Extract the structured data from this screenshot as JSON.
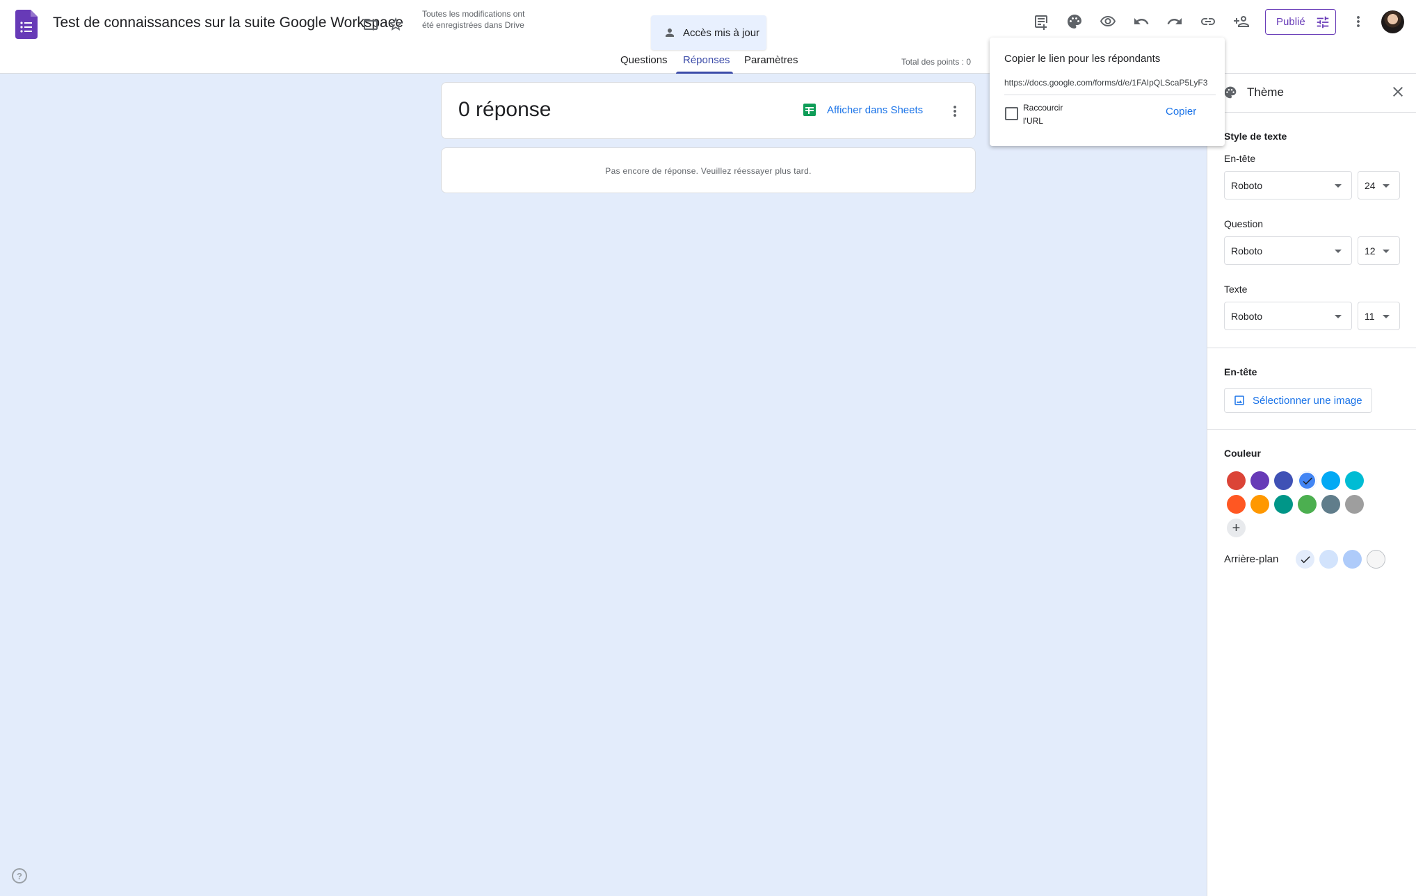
{
  "header": {
    "title": "Test de connaissances sur la suite Google Workspace",
    "save_status": "Toutes les modifications ont été enregistrées dans Drive",
    "access_chip": "Accès mis à jour",
    "publish_label": "Publié",
    "tabs": [
      {
        "label": "Questions",
        "active": false
      },
      {
        "label": "Réponses",
        "active": true
      },
      {
        "label": "Paramètres",
        "active": false
      }
    ],
    "total_points": "Total des points : 0"
  },
  "responses": {
    "count_label": "0 réponse",
    "sheets_label": "Afficher dans Sheets",
    "empty_message": "Pas encore de réponse. Veuillez réessayer plus tard."
  },
  "copy_link": {
    "title": "Copier le lien pour les répondants",
    "url": "https://docs.google.com/forms/d/e/1FAIpQLScaP5LyF3",
    "shorten_label": "Raccourcir l'URL",
    "shorten_checked": false,
    "copy_label": "Copier"
  },
  "theme": {
    "title": "Thème",
    "text_style_label": "Style de texte",
    "header_label": "En-tête",
    "header_font": "Roboto",
    "header_size": "24",
    "question_label": "Question",
    "question_font": "Roboto",
    "question_size": "12",
    "text_label": "Texte",
    "text_font": "Roboto",
    "text_size": "11",
    "header_section_label": "En-tête",
    "select_image_label": "Sélectionner une image",
    "color_label": "Couleur",
    "colors": [
      "#db4437",
      "#673ab7",
      "#3f51b5",
      "#4285f4",
      "#03a9f4",
      "#00bcd4",
      "#ff5722",
      "#ff9800",
      "#009688",
      "#4caf50",
      "#607d8b",
      "#9e9e9e"
    ],
    "selected_color": "#4285f4",
    "background_label": "Arrière-plan",
    "backgrounds": [
      "#e3ecfb",
      "#d2e3fc",
      "#aecbfa",
      "#f6f6f6"
    ],
    "selected_background": "#e3ecfb"
  },
  "icons": {
    "header_right": [
      "addon-icon",
      "palette-icon",
      "preview-icon",
      "undo-icon",
      "redo-icon",
      "link-icon",
      "add-collaborator-icon",
      "more-vert-icon"
    ]
  }
}
